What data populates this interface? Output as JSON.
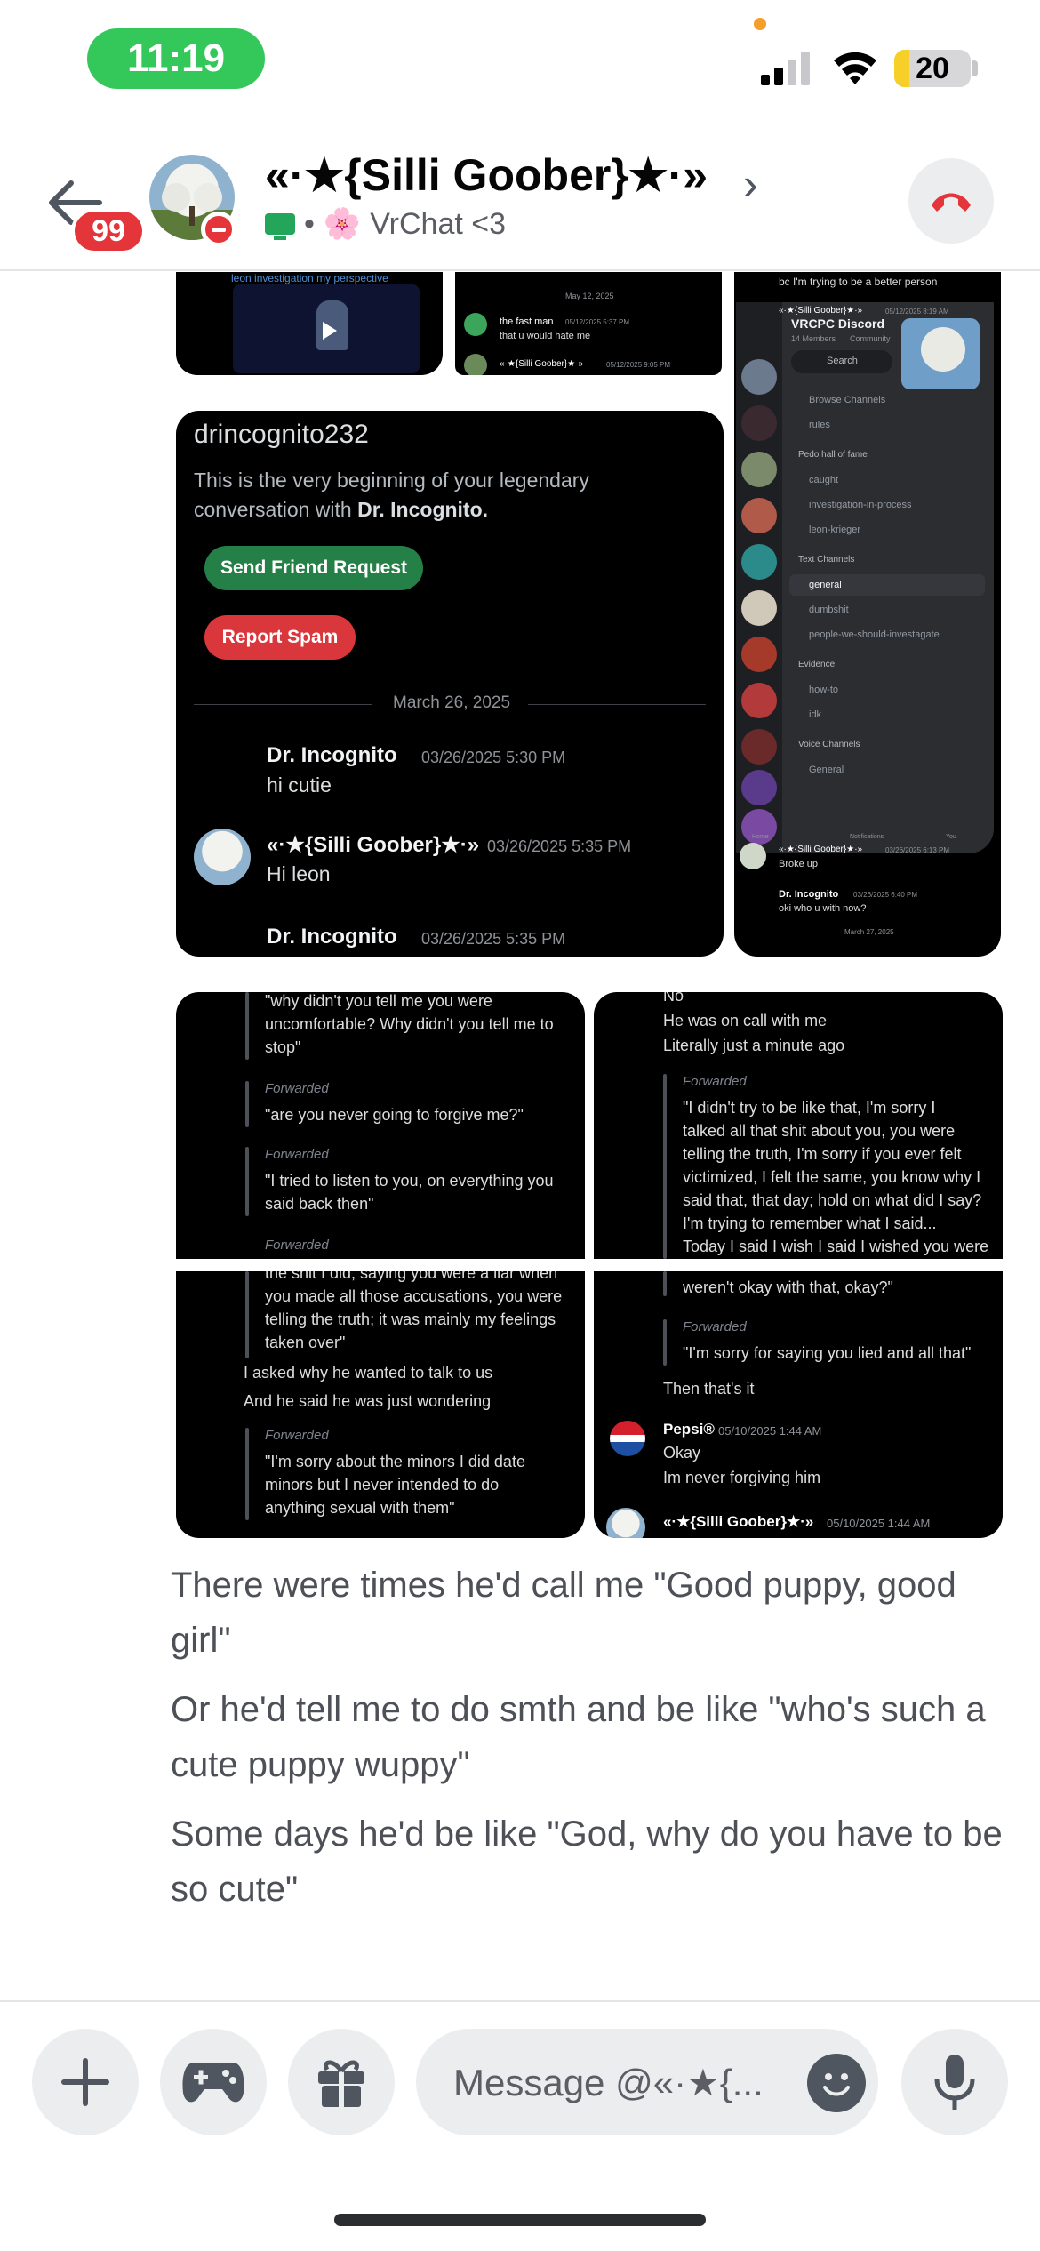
{
  "status_bar": {
    "time": "11:19",
    "battery": "20",
    "battery_level": 0.2
  },
  "header": {
    "badge_count": "99",
    "title": "«·★{Silli Goober}★·»",
    "status_emoji": "🌸",
    "status_text": "VrChat <3",
    "chevron": "›"
  },
  "image_top": {
    "date_label": "May 12, 2025",
    "msg1_name": "the fast man",
    "msg1_time": "05/12/2025 5:37 PM",
    "msg1_text": "that u would hate me",
    "msg2_name": "«·★{Silli Goober}★·»",
    "msg2_time": "05/12/2025 9:05 PM",
    "left_caption": "leon investigation my perspective"
  },
  "image_dm": {
    "username": "drincognito232",
    "intro": "This is the very beginning of your legendary conversation with",
    "intro_name": "Dr. Incognito.",
    "send_friend_label": "Send Friend Request",
    "report_spam_label": "Report Spam",
    "date_divider": "March 26, 2025",
    "messages": [
      {
        "name": "Dr. Incognito",
        "time": "03/26/2025 5:30 PM",
        "text": "hi cutie"
      },
      {
        "name": "«·★{Silli Goober}★·»",
        "time": "03/26/2025 5:35 PM",
        "text": "Hi leon"
      },
      {
        "name": "Dr. Incognito",
        "time": "03/26/2025 5:35 PM",
        "text": ""
      }
    ]
  },
  "image_server": {
    "top_line": "bc I'm trying to be a better person",
    "top_name": "«·★{Silli Goober}★·»",
    "top_time": "05/12/2025 8:19 AM",
    "server_name": "VRCPC Discord",
    "members": "14 Members",
    "community": "Community",
    "search": "Search",
    "browse": "Browse Channels",
    "rules": "rules",
    "cat_hall": "Pedo hall of fame",
    "ch_hall": [
      "caught",
      "investigation-in-process",
      "leon-krieger"
    ],
    "cat_text": "Text Channels",
    "ch_text": [
      "general",
      "dumbshit",
      "people-we-should-investagate"
    ],
    "cat_evidence": "Evidence",
    "ch_evidence": [
      "how-to",
      "idk"
    ],
    "cat_voice": "Voice Channels",
    "ch_voice": [
      "General"
    ],
    "nav_home": "Home",
    "nav_notifications": "Notifications",
    "nav_you": "You",
    "lower_name1": "«·★{Silli Goober}★·»",
    "lower_time1": "03/26/2025 6:13 PM",
    "lower_text1": "Broke up",
    "lower_name2": "Dr. Incognito",
    "lower_time2": "03/26/2025 6:40 PM",
    "lower_text2": "oki who u with now?",
    "lower_date": "March 27, 2025"
  },
  "image_q1": {
    "line1": "\"why didn't you tell me you were",
    "line2": "uncomfortable? Why didn't you tell me to",
    "line3": "stop\"",
    "fwd": "Forwarded",
    "q2": "\"are you never going to forgive me?\"",
    "q3a": "\"I tried to listen to you, on everything you",
    "q3b": "said back then\""
  },
  "image_q2": {
    "top": "No",
    "l1": "He was on call with me",
    "l2": "Literally just a minute ago",
    "fwd": "Forwarded",
    "q": [
      "\"I didn't try to be like that, I'm sorry I",
      "talked all that shit about you, you were",
      "telling the truth, I'm sorry if you ever felt",
      "victimized, I felt the same, you know why I",
      "said that, that day; hold on what did I say?",
      "I'm trying to remember what I said...",
      "Today I said I wish I said I wished you were"
    ]
  },
  "image_q3": {
    "q": [
      "the shit I did, saying you were a liar when",
      "you made all those accusations, you were",
      "telling the truth; it was mainly my feelings",
      "taken over\""
    ],
    "l1": "I asked why he wanted to talk to us",
    "l2": "And he said he was just wondering",
    "fwd": "Forwarded",
    "q2": [
      "\"I'm sorry about the minors I did date",
      "minors but I never intended to do",
      "anything sexual with them\""
    ]
  },
  "image_q4": {
    "q1": "weren't okay with that, okay?\"",
    "fwd": "Forwarded",
    "q2": "\"I'm sorry for saying you lied and all that\"",
    "l1": "Then that's it",
    "name1": "Pepsi®",
    "time1": "05/10/2025 1:44 AM",
    "t1": "Okay",
    "t2": "Im never forgiving him",
    "name2": "«·★{Silli Goober}★·»",
    "time2": "05/10/2025 1:44 AM"
  },
  "messages": [
    "There were times he'd call me \"Good puppy, good girl\"",
    "Or he'd tell me to do smth and be like \"who's such a cute puppy wuppy\"",
    "Some days he'd be like \"God, why do you have to be so cute\""
  ],
  "composer": {
    "placeholder": "Message @«·★{..."
  },
  "icons": {
    "back": "arrow-left-icon",
    "call": "end-call-icon",
    "add": "plus-icon",
    "games": "gamepad-icon",
    "gift": "gift-icon",
    "emoji": "emoji-icon",
    "mic": "microphone-icon"
  }
}
